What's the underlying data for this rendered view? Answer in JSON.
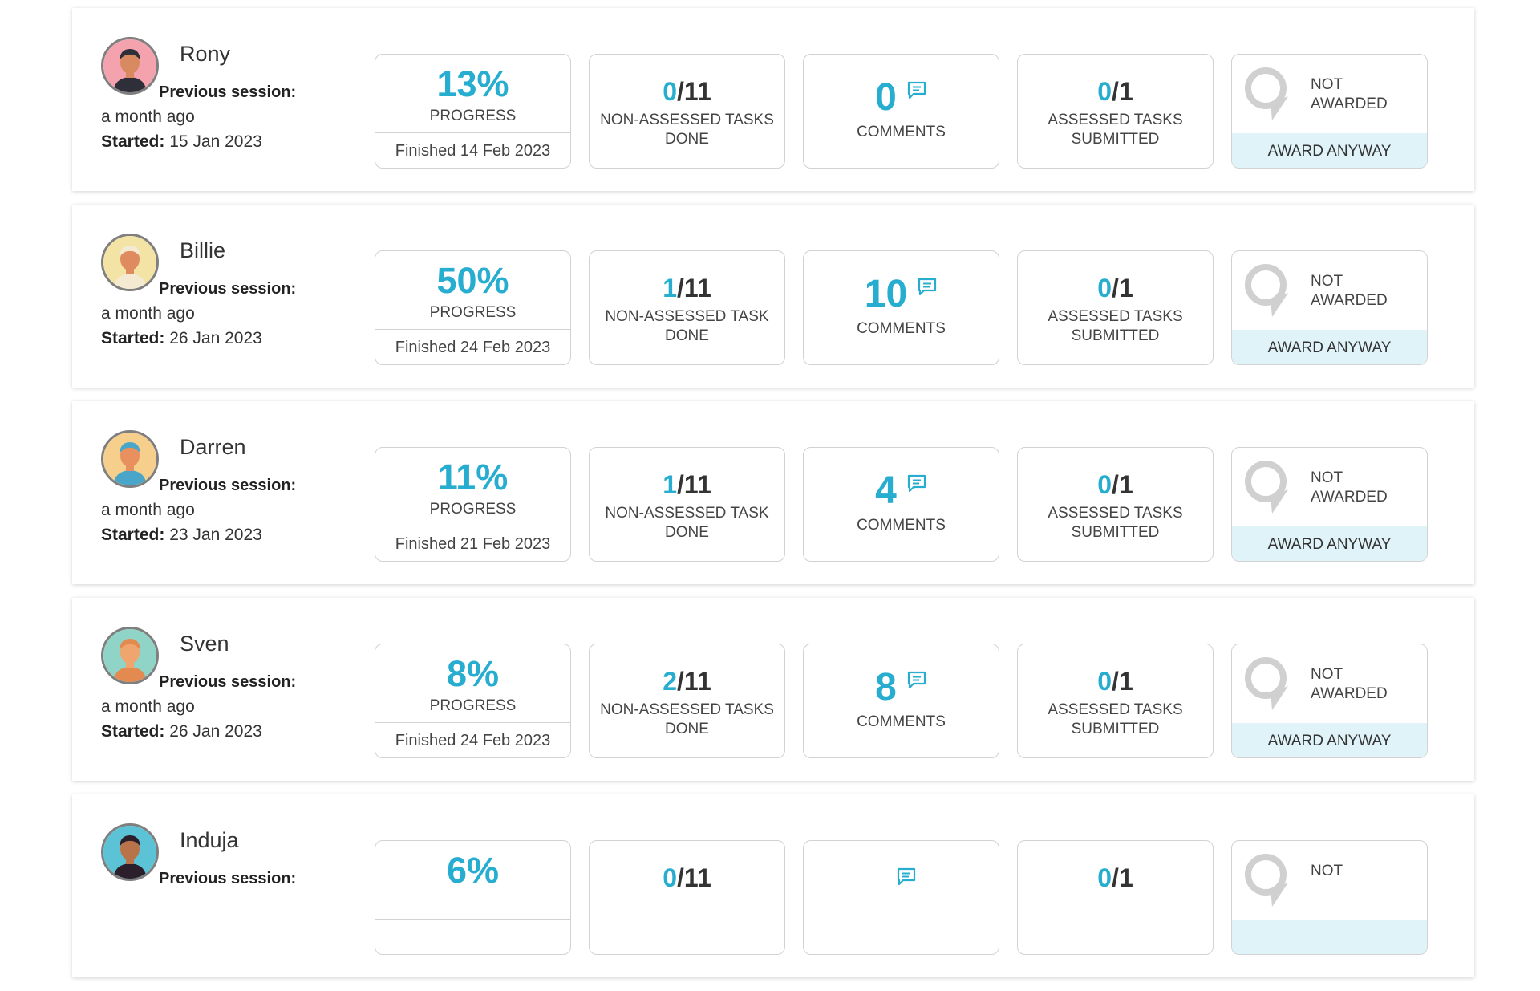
{
  "students": [
    {
      "name": "Rony",
      "previous_session_label": "Previous session:",
      "previous_session_value": "a month ago",
      "started_label": "Started:",
      "started_date": "15 Jan 2023",
      "progress": {
        "value": "13%",
        "label": "PROGRESS",
        "finished": "Finished 14 Feb 2023"
      },
      "non_assessed": {
        "done": "0",
        "total": "/11",
        "label": "NON-ASSESSED TASKS DONE"
      },
      "comments": {
        "count": "0",
        "label": "COMMENTS"
      },
      "assessed": {
        "done": "0",
        "total": "/1",
        "label": "ASSESSED TASKS SUBMITTED"
      },
      "award": {
        "status_line1": "NOT",
        "status_line2": "AWARDED",
        "button": "AWARD ANYWAY"
      },
      "avatar": {
        "icon": "bearded-man-avatar",
        "bg": "#f4a3ae",
        "skin": "#d9895f",
        "hair": "#2f2f3a"
      }
    },
    {
      "name": "Billie",
      "previous_session_label": "Previous session:",
      "previous_session_value": "a month ago",
      "started_label": "Started:",
      "started_date": "26 Jan 2023",
      "progress": {
        "value": "50%",
        "label": "PROGRESS",
        "finished": "Finished 24 Feb 2023"
      },
      "non_assessed": {
        "done": "1",
        "total": "/11",
        "label": "NON-ASSESSED TASK DONE"
      },
      "comments": {
        "count": "10",
        "label": "COMMENTS"
      },
      "assessed": {
        "done": "0",
        "total": "/1",
        "label": "ASSESSED TASKS SUBMITTED"
      },
      "award": {
        "status_line1": "NOT",
        "status_line2": "AWARDED",
        "button": "AWARD ANYWAY"
      },
      "avatar": {
        "icon": "blonde-woman-avatar",
        "bg": "#f3e3a5",
        "skin": "#e08a5f",
        "hair": "#f4ead2"
      }
    },
    {
      "name": "Darren",
      "previous_session_label": "Previous session:",
      "previous_session_value": "a month ago",
      "started_label": "Started:",
      "started_date": "23 Jan 2023",
      "progress": {
        "value": "11%",
        "label": "PROGRESS",
        "finished": "Finished 21 Feb 2023"
      },
      "non_assessed": {
        "done": "1",
        "total": "/11",
        "label": "NON-ASSESSED TASK DONE"
      },
      "comments": {
        "count": "4",
        "label": "COMMENTS"
      },
      "assessed": {
        "done": "0",
        "total": "/1",
        "label": "ASSESSED TASKS SUBMITTED"
      },
      "award": {
        "status_line1": "NOT",
        "status_line2": "AWARDED",
        "button": "AWARD ANYWAY"
      },
      "avatar": {
        "icon": "blue-hair-man-avatar",
        "bg": "#f6cf8d",
        "skin": "#e8915e",
        "hair": "#4aa6c8"
      }
    },
    {
      "name": "Sven",
      "previous_session_label": "Previous session:",
      "previous_session_value": "a month ago",
      "started_label": "Started:",
      "started_date": "26 Jan 2023",
      "progress": {
        "value": "8%",
        "label": "PROGRESS",
        "finished": "Finished 24 Feb 2023"
      },
      "non_assessed": {
        "done": "2",
        "total": "/11",
        "label": "NON-ASSESSED TASKS DONE"
      },
      "comments": {
        "count": "8",
        "label": "COMMENTS"
      },
      "assessed": {
        "done": "0",
        "total": "/1",
        "label": "ASSESSED TASKS SUBMITTED"
      },
      "award": {
        "status_line1": "NOT",
        "status_line2": "AWARDED",
        "button": "AWARD ANYWAY"
      },
      "avatar": {
        "icon": "bald-bearded-man-avatar",
        "bg": "#8fd4c6",
        "skin": "#f0a56e",
        "hair": "#e28a4f"
      }
    },
    {
      "name": "Induja",
      "previous_session_label": "Previous session:",
      "previous_session_value": "",
      "started_label": "",
      "started_date": "",
      "progress": {
        "value": "6%",
        "label": "",
        "finished": ""
      },
      "non_assessed": {
        "done": "0",
        "total": "/11",
        "label": ""
      },
      "comments": {
        "count": "",
        "label": ""
      },
      "assessed": {
        "done": "0",
        "total": "/1",
        "label": ""
      },
      "award": {
        "status_line1": "NOT",
        "status_line2": "",
        "button": ""
      },
      "avatar": {
        "icon": "dark-hair-woman-avatar",
        "bg": "#5cc3d6",
        "skin": "#b8734a",
        "hair": "#2a1f2a"
      }
    }
  ],
  "colors": {
    "accent": "#26adcf",
    "award_button_bg": "#dff3f9",
    "tile_border": "#d2d2d2"
  }
}
